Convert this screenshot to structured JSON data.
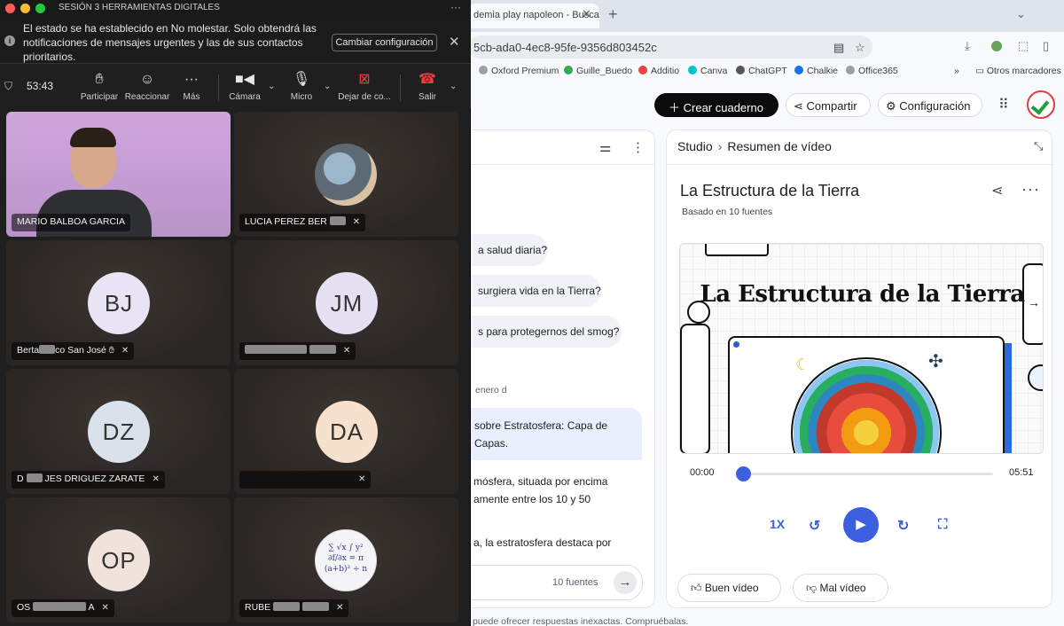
{
  "meeting": {
    "window_title": "SESIÓN 3 HERRAMIENTAS DIGITALES",
    "notification": {
      "text": "El estado se ha establecido en No molestar. Solo obtendrá las notificaciones de mensajes urgentes y las de sus contactos prioritarios.",
      "button": "Cambiar configuración"
    },
    "timer": "53:43",
    "controls": [
      {
        "label": "Participar",
        "icon": "raise-hand-icon"
      },
      {
        "label": "Reaccionar",
        "icon": "smile-icon"
      },
      {
        "label": "Más",
        "icon": "more-icon"
      },
      {
        "label": "Cámara",
        "icon": "camera-icon"
      },
      {
        "label": "Micro",
        "icon": "microphone-icon"
      },
      {
        "label": "Dejar de co...",
        "icon": "stop-share-icon"
      },
      {
        "label": "Salir",
        "icon": "leave-phone-icon"
      }
    ],
    "participants": [
      {
        "name": "MARIO BALBOA GARCIA",
        "type": "video"
      },
      {
        "name": "LUCIA PEREZ BER",
        "type": "photo"
      },
      {
        "initials": "BJ",
        "name_start": "Berta",
        "name_end": "co San José",
        "color": "#e8e4f4"
      },
      {
        "initials": "JM",
        "color": "#e6e1f2"
      },
      {
        "initials": "DZ",
        "name_start": "D",
        "name_mid": "JES",
        "name_end": "DRIGUEZ ZARATE",
        "color": "#d9e2ea"
      },
      {
        "initials": "DA",
        "color": "#f6e2cc"
      },
      {
        "initials": "OP",
        "name_start": "OS",
        "name_end": "A",
        "color": "#efe3dc"
      },
      {
        "name_start": "RUBE",
        "type": "math"
      }
    ]
  },
  "browser": {
    "tab_title": "demia play napoleon - Busca",
    "url": "5cb-ada0-4ec8-95fe-9356d803452c",
    "bookmarks": [
      {
        "label": "Oxford Premium",
        "color": "#9aa0a6"
      },
      {
        "label": "Guille_Buedo",
        "color": "#34a853"
      },
      {
        "label": "Additio",
        "color": "#e8453c"
      },
      {
        "label": "Canva",
        "color": "#00c4cc"
      },
      {
        "label": "ChatGPT",
        "color": "#555555"
      },
      {
        "label": "Chalkie",
        "color": "#1a73e8"
      },
      {
        "label": "Office365",
        "color": "#9aa0a6"
      }
    ],
    "other_bookmarks": "Otros marcadores"
  },
  "notebook": {
    "create_button": "Crear cuaderno",
    "share_button": "Compartir",
    "settings_button": "Configuración",
    "chat": {
      "suggestions": [
        "a salud diaria?",
        "surgiera vida en la Tierra?",
        "s para protegernos del smog?"
      ],
      "date": "enero d",
      "user_message": "sobre Estratosfera: Capa de Capas.",
      "answer_lines": [
        "mósfera, situada por encima",
        "amente entre los 10 y 50",
        "a, la estratosfera destaca por"
      ],
      "sources": "10 fuentes",
      "disclaimer": "puede ofrecer respuestas inexactas. Compruébalas."
    },
    "studio": {
      "breadcrumb_root": "Studio",
      "breadcrumb_current": "Resumen de vídeo",
      "title": "La Estructura de la Tierra",
      "subtitle": "Basado en 10 fuentes",
      "slide_title": "La Estructura de la Tierra",
      "time_current": "00:00",
      "time_total": "05:51",
      "progress": 0.0,
      "speed": "1X",
      "feedback_good": "Buen vídeo",
      "feedback_bad": "Mal vídeo"
    }
  },
  "colors": {
    "accent": "#3c5fe0",
    "meeting_bg": "#1f1f1f",
    "leave_red": "#e4413e"
  }
}
